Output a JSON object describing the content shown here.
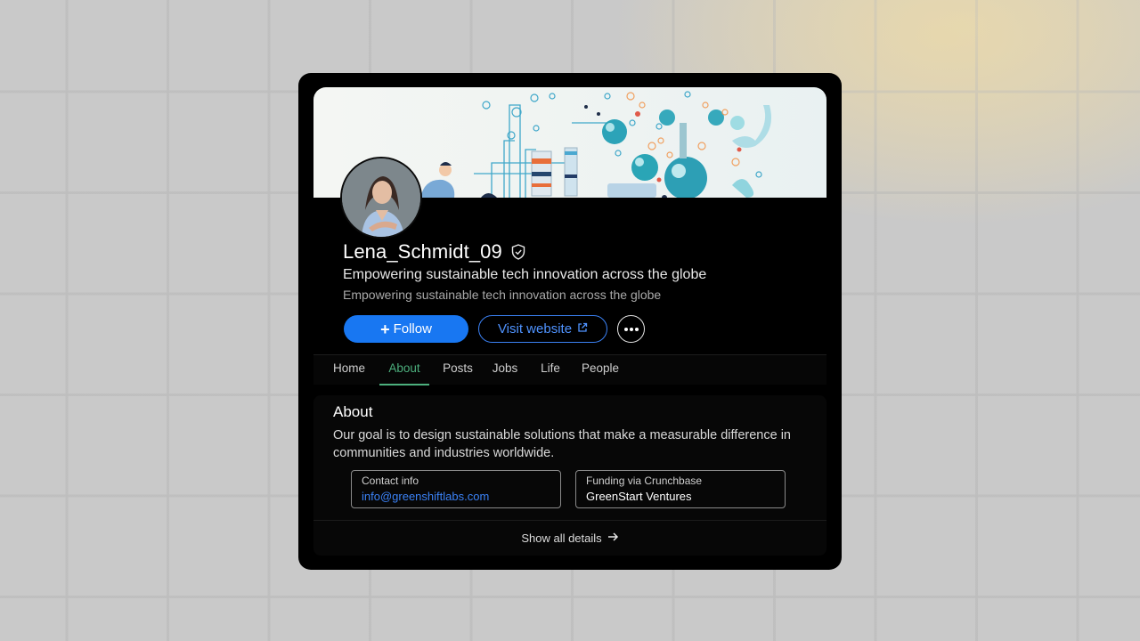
{
  "profile": {
    "name": "Lena_Schmidt_09",
    "verified_icon": "shield-check-icon",
    "headline": "Empowering sustainable tech innovation across the globe",
    "subheadline": "Empowering sustainable tech innovation across the globe"
  },
  "actions": {
    "follow_label": "Follow",
    "follow_icon": "+",
    "website_label": "Visit website",
    "website_icon": "external-link-icon",
    "more_icon": "more-horizontal-icon"
  },
  "tabs": [
    {
      "label": "Home",
      "active": false
    },
    {
      "label": "About",
      "active": true
    },
    {
      "label": "Posts",
      "active": false
    },
    {
      "label": "Jobs",
      "active": false
    },
    {
      "label": "Life",
      "active": false
    },
    {
      "label": "People",
      "active": false
    }
  ],
  "about": {
    "title": "About",
    "text": "Our goal is to design sustainable solutions that make a measurable difference in communities and industries worldwide.",
    "contact": {
      "label": "Contact info",
      "value": "info@greenshiftlabs.com"
    },
    "funding": {
      "label": "Funding via Crunchbase",
      "value": "GreenStart Ventures"
    },
    "show_all_label": "Show all details"
  },
  "colors": {
    "accent_blue": "#1877f2",
    "active_tab_green": "#4caf7d",
    "card_background": "#000000"
  }
}
